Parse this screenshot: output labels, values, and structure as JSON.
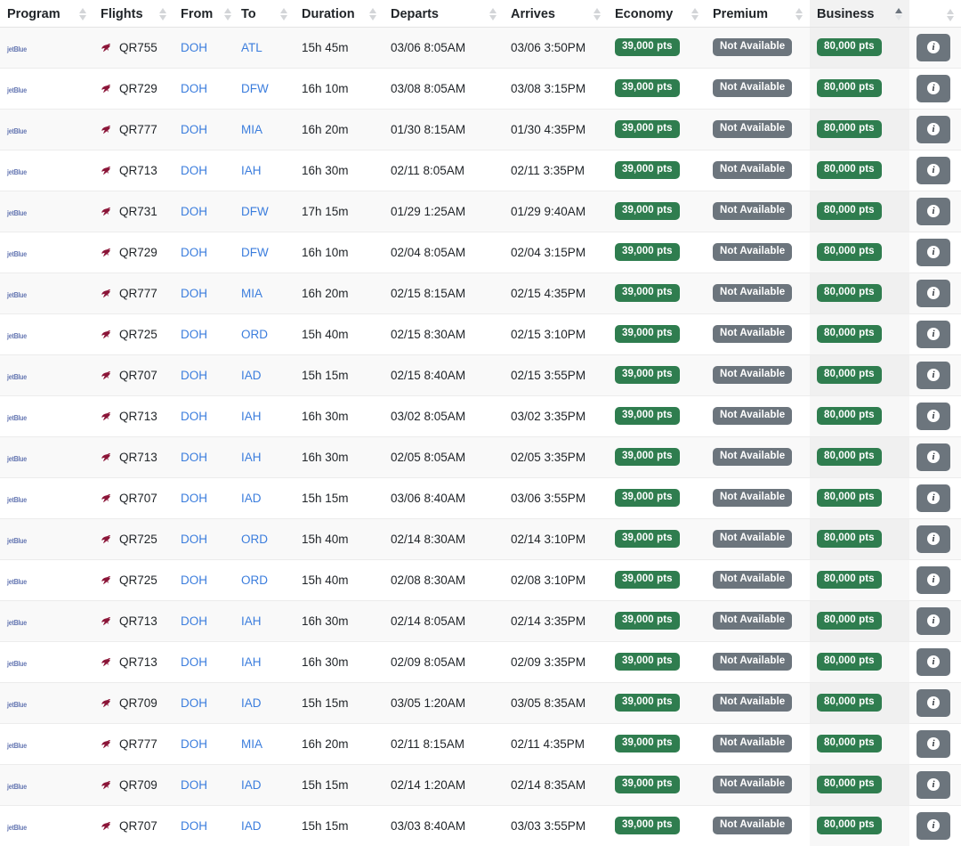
{
  "table": {
    "columns": [
      {
        "key": "program",
        "label": "Program",
        "sortable": true,
        "sorted": "none"
      },
      {
        "key": "flights",
        "label": "Flights",
        "sortable": true,
        "sorted": "none"
      },
      {
        "key": "from",
        "label": "From",
        "sortable": true,
        "sorted": "none"
      },
      {
        "key": "to",
        "label": "To",
        "sortable": true,
        "sorted": "none"
      },
      {
        "key": "duration",
        "label": "Duration",
        "sortable": true,
        "sorted": "none"
      },
      {
        "key": "departs",
        "label": "Departs",
        "sortable": true,
        "sorted": "none"
      },
      {
        "key": "arrives",
        "label": "Arrives",
        "sortable": true,
        "sorted": "none"
      },
      {
        "key": "economy",
        "label": "Economy",
        "sortable": true,
        "sorted": "none"
      },
      {
        "key": "premium",
        "label": "Premium",
        "sortable": true,
        "sorted": "none"
      },
      {
        "key": "business",
        "label": "Business",
        "sortable": true,
        "sorted": "asc"
      },
      {
        "key": "actions",
        "label": "",
        "sortable": true,
        "sorted": "none"
      }
    ],
    "program_logo_text": "jetBlue",
    "airline_icon": "qatar-airways-oryx-icon",
    "info_icon": "info-icon",
    "info_glyph": "i",
    "sort_icon": "sort-arrows-icon",
    "colors": {
      "available": "#2f7d4f",
      "unavailable": "#6c757d",
      "link": "#3b7ddd",
      "text": "#212529",
      "sorted_column_bg": "#f0f0f0",
      "airline_mark": "#8b1538"
    },
    "rows": [
      {
        "program": "jetBlue",
        "flight": "QR755",
        "from": "DOH",
        "to": "ATL",
        "duration": "15h 45m",
        "departs": "03/06 8:05AM",
        "arrives": "03/06 3:50PM",
        "economy": "39,000 pts",
        "premium": "Not Available",
        "business": "80,000 pts",
        "economy_available": true,
        "premium_available": false,
        "business_available": true
      },
      {
        "program": "jetBlue",
        "flight": "QR729",
        "from": "DOH",
        "to": "DFW",
        "duration": "16h 10m",
        "departs": "03/08 8:05AM",
        "arrives": "03/08 3:15PM",
        "economy": "39,000 pts",
        "premium": "Not Available",
        "business": "80,000 pts",
        "economy_available": true,
        "premium_available": false,
        "business_available": true
      },
      {
        "program": "jetBlue",
        "flight": "QR777",
        "from": "DOH",
        "to": "MIA",
        "duration": "16h 20m",
        "departs": "01/30 8:15AM",
        "arrives": "01/30 4:35PM",
        "economy": "39,000 pts",
        "premium": "Not Available",
        "business": "80,000 pts",
        "economy_available": true,
        "premium_available": false,
        "business_available": true
      },
      {
        "program": "jetBlue",
        "flight": "QR713",
        "from": "DOH",
        "to": "IAH",
        "duration": "16h 30m",
        "departs": "02/11 8:05AM",
        "arrives": "02/11 3:35PM",
        "economy": "39,000 pts",
        "premium": "Not Available",
        "business": "80,000 pts",
        "economy_available": true,
        "premium_available": false,
        "business_available": true
      },
      {
        "program": "jetBlue",
        "flight": "QR731",
        "from": "DOH",
        "to": "DFW",
        "duration": "17h 15m",
        "departs": "01/29 1:25AM",
        "arrives": "01/29 9:40AM",
        "economy": "39,000 pts",
        "premium": "Not Available",
        "business": "80,000 pts",
        "economy_available": true,
        "premium_available": false,
        "business_available": true
      },
      {
        "program": "jetBlue",
        "flight": "QR729",
        "from": "DOH",
        "to": "DFW",
        "duration": "16h 10m",
        "departs": "02/04 8:05AM",
        "arrives": "02/04 3:15PM",
        "economy": "39,000 pts",
        "premium": "Not Available",
        "business": "80,000 pts",
        "economy_available": true,
        "premium_available": false,
        "business_available": true
      },
      {
        "program": "jetBlue",
        "flight": "QR777",
        "from": "DOH",
        "to": "MIA",
        "duration": "16h 20m",
        "departs": "02/15 8:15AM",
        "arrives": "02/15 4:35PM",
        "economy": "39,000 pts",
        "premium": "Not Available",
        "business": "80,000 pts",
        "economy_available": true,
        "premium_available": false,
        "business_available": true
      },
      {
        "program": "jetBlue",
        "flight": "QR725",
        "from": "DOH",
        "to": "ORD",
        "duration": "15h 40m",
        "departs": "02/15 8:30AM",
        "arrives": "02/15 3:10PM",
        "economy": "39,000 pts",
        "premium": "Not Available",
        "business": "80,000 pts",
        "economy_available": true,
        "premium_available": false,
        "business_available": true
      },
      {
        "program": "jetBlue",
        "flight": "QR707",
        "from": "DOH",
        "to": "IAD",
        "duration": "15h 15m",
        "departs": "02/15 8:40AM",
        "arrives": "02/15 3:55PM",
        "economy": "39,000 pts",
        "premium": "Not Available",
        "business": "80,000 pts",
        "economy_available": true,
        "premium_available": false,
        "business_available": true
      },
      {
        "program": "jetBlue",
        "flight": "QR713",
        "from": "DOH",
        "to": "IAH",
        "duration": "16h 30m",
        "departs": "03/02 8:05AM",
        "arrives": "03/02 3:35PM",
        "economy": "39,000 pts",
        "premium": "Not Available",
        "business": "80,000 pts",
        "economy_available": true,
        "premium_available": false,
        "business_available": true
      },
      {
        "program": "jetBlue",
        "flight": "QR713",
        "from": "DOH",
        "to": "IAH",
        "duration": "16h 30m",
        "departs": "02/05 8:05AM",
        "arrives": "02/05 3:35PM",
        "economy": "39,000 pts",
        "premium": "Not Available",
        "business": "80,000 pts",
        "economy_available": true,
        "premium_available": false,
        "business_available": true
      },
      {
        "program": "jetBlue",
        "flight": "QR707",
        "from": "DOH",
        "to": "IAD",
        "duration": "15h 15m",
        "departs": "03/06 8:40AM",
        "arrives": "03/06 3:55PM",
        "economy": "39,000 pts",
        "premium": "Not Available",
        "business": "80,000 pts",
        "economy_available": true,
        "premium_available": false,
        "business_available": true
      },
      {
        "program": "jetBlue",
        "flight": "QR725",
        "from": "DOH",
        "to": "ORD",
        "duration": "15h 40m",
        "departs": "02/14 8:30AM",
        "arrives": "02/14 3:10PM",
        "economy": "39,000 pts",
        "premium": "Not Available",
        "business": "80,000 pts",
        "economy_available": true,
        "premium_available": false,
        "business_available": true
      },
      {
        "program": "jetBlue",
        "flight": "QR725",
        "from": "DOH",
        "to": "ORD",
        "duration": "15h 40m",
        "departs": "02/08 8:30AM",
        "arrives": "02/08 3:10PM",
        "economy": "39,000 pts",
        "premium": "Not Available",
        "business": "80,000 pts",
        "economy_available": true,
        "premium_available": false,
        "business_available": true
      },
      {
        "program": "jetBlue",
        "flight": "QR713",
        "from": "DOH",
        "to": "IAH",
        "duration": "16h 30m",
        "departs": "02/14 8:05AM",
        "arrives": "02/14 3:35PM",
        "economy": "39,000 pts",
        "premium": "Not Available",
        "business": "80,000 pts",
        "economy_available": true,
        "premium_available": false,
        "business_available": true
      },
      {
        "program": "jetBlue",
        "flight": "QR713",
        "from": "DOH",
        "to": "IAH",
        "duration": "16h 30m",
        "departs": "02/09 8:05AM",
        "arrives": "02/09 3:35PM",
        "economy": "39,000 pts",
        "premium": "Not Available",
        "business": "80,000 pts",
        "economy_available": true,
        "premium_available": false,
        "business_available": true
      },
      {
        "program": "jetBlue",
        "flight": "QR709",
        "from": "DOH",
        "to": "IAD",
        "duration": "15h 15m",
        "departs": "03/05 1:20AM",
        "arrives": "03/05 8:35AM",
        "economy": "39,000 pts",
        "premium": "Not Available",
        "business": "80,000 pts",
        "economy_available": true,
        "premium_available": false,
        "business_available": true
      },
      {
        "program": "jetBlue",
        "flight": "QR777",
        "from": "DOH",
        "to": "MIA",
        "duration": "16h 20m",
        "departs": "02/11 8:15AM",
        "arrives": "02/11 4:35PM",
        "economy": "39,000 pts",
        "premium": "Not Available",
        "business": "80,000 pts",
        "economy_available": true,
        "premium_available": false,
        "business_available": true
      },
      {
        "program": "jetBlue",
        "flight": "QR709",
        "from": "DOH",
        "to": "IAD",
        "duration": "15h 15m",
        "departs": "02/14 1:20AM",
        "arrives": "02/14 8:35AM",
        "economy": "39,000 pts",
        "premium": "Not Available",
        "business": "80,000 pts",
        "economy_available": true,
        "premium_available": false,
        "business_available": true
      },
      {
        "program": "jetBlue",
        "flight": "QR707",
        "from": "DOH",
        "to": "IAD",
        "duration": "15h 15m",
        "departs": "03/03 8:40AM",
        "arrives": "03/03 3:55PM",
        "economy": "39,000 pts",
        "premium": "Not Available",
        "business": "80,000 pts",
        "economy_available": true,
        "premium_available": false,
        "business_available": true
      }
    ]
  }
}
